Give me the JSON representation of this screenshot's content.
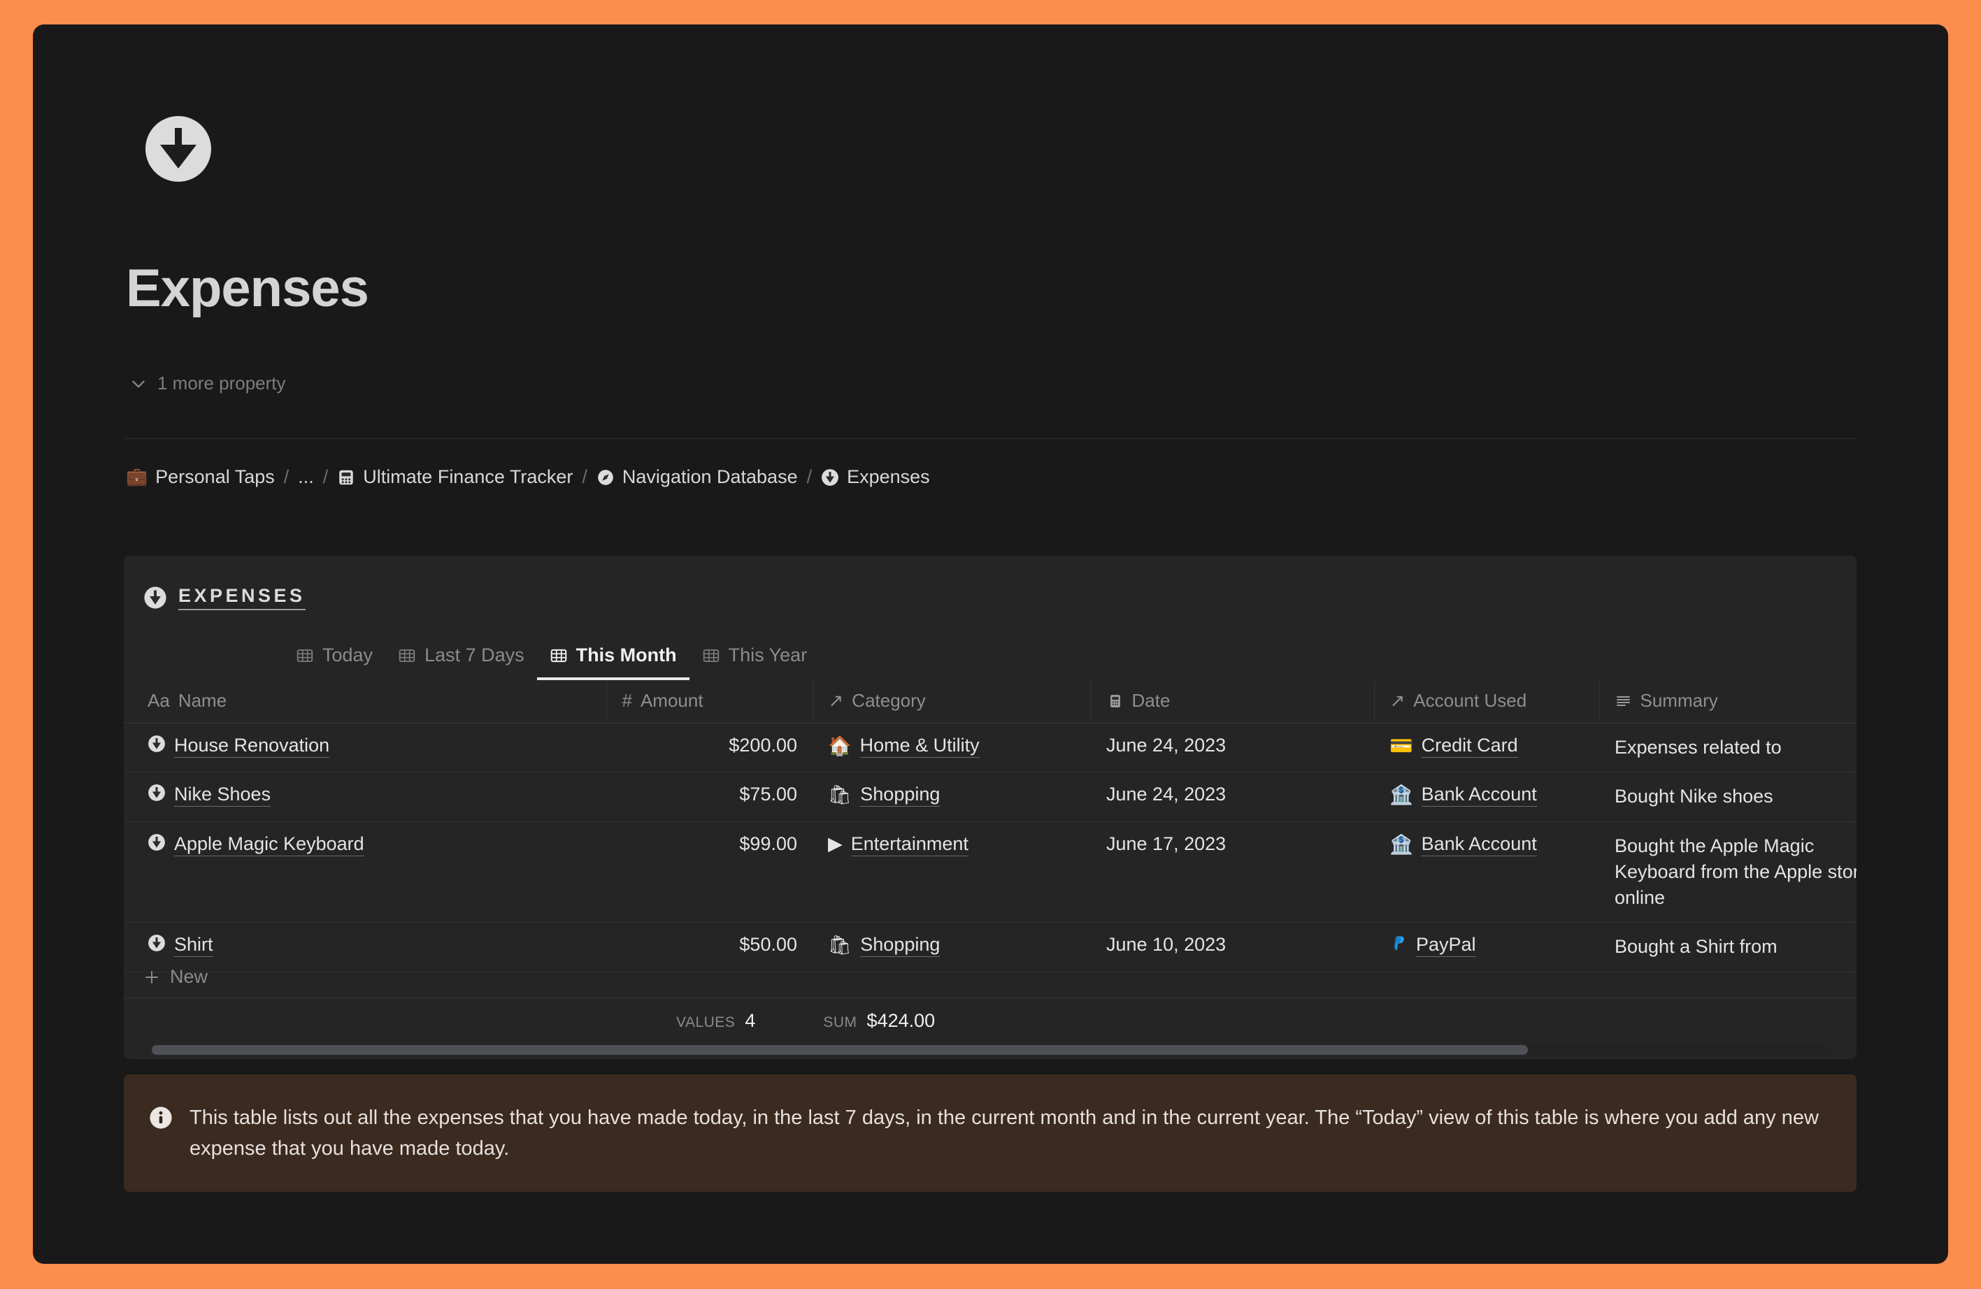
{
  "window": {
    "background_color": "#fb8d4e",
    "page_background": "#191919"
  },
  "page": {
    "icon": "circle-down-arrow-icon",
    "title": "Expenses",
    "more_property_label": "1 more property"
  },
  "breadcrumb": {
    "items": [
      {
        "icon": "briefcase-emoji",
        "emoji": "💼",
        "label": "Personal Taps"
      },
      {
        "icon": "ellipsis",
        "emoji": "",
        "label": "..."
      },
      {
        "icon": "calculator-icon",
        "emoji": "",
        "label": "Ultimate Finance Tracker"
      },
      {
        "icon": "compass-icon",
        "emoji": "",
        "label": "Navigation Database"
      },
      {
        "icon": "circle-down-arrow-icon",
        "emoji": "",
        "label": "Expenses"
      }
    ],
    "separator": "/"
  },
  "database": {
    "icon": "circle-down-arrow-icon",
    "title": "EXPENSES",
    "tabs": [
      {
        "label": "Today",
        "icon": "table-icon",
        "active": false
      },
      {
        "label": "Last 7 Days",
        "icon": "table-icon",
        "active": false
      },
      {
        "label": "This Month",
        "icon": "table-icon",
        "active": true
      },
      {
        "label": "This Year",
        "icon": "table-icon",
        "active": false
      }
    ],
    "columns": [
      {
        "label": "Name",
        "icon": "title-aa-icon",
        "glyph": "Aa"
      },
      {
        "label": "Amount",
        "icon": "number-hash-icon",
        "glyph": "#"
      },
      {
        "label": "Category",
        "icon": "relation-arrow-icon",
        "glyph": "↗"
      },
      {
        "label": "Date",
        "icon": "calendar-icon",
        "glyph": ""
      },
      {
        "label": "Account Used",
        "icon": "relation-arrow-icon",
        "glyph": "↗"
      },
      {
        "label": "Summary",
        "icon": "text-lines-icon",
        "glyph": ""
      }
    ],
    "rows": [
      {
        "name": "House Renovation",
        "name_icon": "circle-down-arrow-icon",
        "amount": "$200.00",
        "category": "Home & Utility",
        "category_icon": "house-emoji",
        "category_emoji": "🏠",
        "date": "June 24, 2023",
        "account": "Credit Card",
        "account_icon": "credit-card-emoji",
        "account_emoji": "💳",
        "summary": "Expenses related to"
      },
      {
        "name": "Nike Shoes",
        "name_icon": "circle-down-arrow-icon",
        "amount": "$75.00",
        "category": "Shopping",
        "category_icon": "shopping-bag-emoji",
        "category_emoji": "🛍",
        "date": "June 24, 2023",
        "account": "Bank Account",
        "account_icon": "bank-emoji",
        "account_emoji": "🏦",
        "summary": "Bought Nike shoes"
      },
      {
        "name": "Apple Magic Keyboard",
        "name_icon": "circle-down-arrow-icon",
        "amount": "$99.00",
        "category": "Entertainment",
        "category_icon": "play-button-emoji",
        "category_emoji": "▶",
        "date": "June 17, 2023",
        "account": "Bank Account",
        "account_icon": "bank-emoji",
        "account_emoji": "🏦",
        "summary": "Bought the Apple Magic Keyboard from the Apple store online"
      },
      {
        "name": "Shirt",
        "name_icon": "circle-down-arrow-icon",
        "amount": "$50.00",
        "category": "Shopping",
        "category_icon": "shopping-bag-emoji",
        "category_emoji": "🛍",
        "date": "June 10, 2023",
        "account": "PayPal",
        "account_icon": "paypal-logo-icon",
        "account_emoji": "",
        "summary": "Bought a Shirt from"
      }
    ],
    "new_row_label": "New",
    "aggregates": {
      "values_label": "VALUES",
      "values_count": "4",
      "sum_label": "SUM",
      "sum_value": "$424.00"
    }
  },
  "callout": {
    "icon": "info-icon",
    "background_color": "#3b2a20",
    "text": "This table lists out all the expenses that you have made today, in the last 7 days, in the current month and in the current year. The “Today” view of this table is where you add any new expense that you have made today."
  }
}
